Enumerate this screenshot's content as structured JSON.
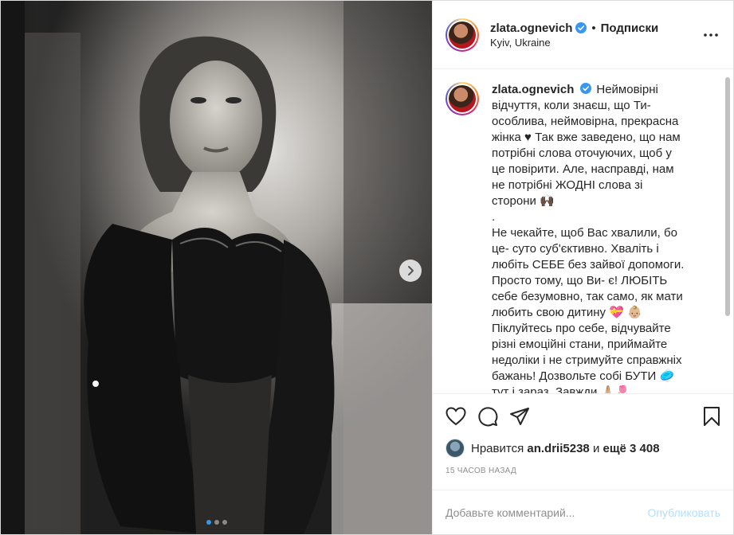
{
  "header": {
    "username": "zlata.ognevich",
    "separator": "•",
    "follow_label": "Подписки",
    "location": "Kyiv, Ukraine"
  },
  "caption": {
    "username": "zlata.ognevich",
    "paragraphs": [
      "Неймовірні відчуття, коли знаєш, що Ти- особлива, неймовірна, прекрасна жінка ♥ Так вже заведено, що нам потрібні слова оточуючих, щоб у це повірити. Але, насправді, нам не потрібні ЖОДНІ слова зі сторони 🙌🏿",
      ".",
      "Не чекайте, щоб Вас хвалили, бо це- суто суб'єктивно. Хваліть і любіть СЕБЕ без зайвої допомоги. Просто тому, що Ви- є! ЛЮБІТЬ себе безумовно, так само, як мати любить свою дитину 💝 👶🏼",
      "Піклуйтесь про себе, відчувайте різні емоційні стани, приймайте недоліки і не стримуйте справжніх бажань! Дозвольте собі БУТИ 🥏 тут і зараз. Завжди 🙏🏼🌷"
    ]
  },
  "likes": {
    "prefix": "Нравится",
    "liker": "an.drii5238",
    "conjunction": "и",
    "others": "ещё 3 408"
  },
  "timestamp": "15 часов назад",
  "comment": {
    "placeholder": "Добавьте комментарий...",
    "publish_label": "Опубликовать"
  },
  "carousel": {
    "total": 3,
    "current": 1
  },
  "colors": {
    "verified": "#3897f0",
    "dot_active": "#3797f0",
    "publish_disabled": "#b2dffc"
  }
}
